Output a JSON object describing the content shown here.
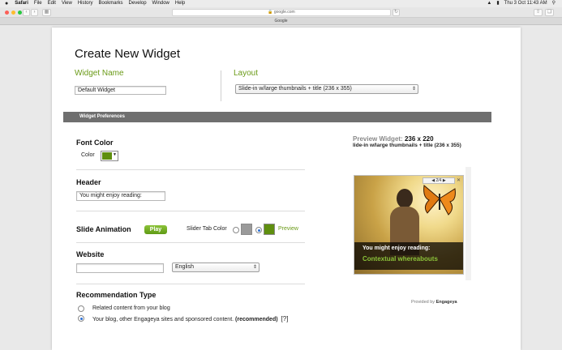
{
  "menubar": {
    "apple": "",
    "items": [
      "Safari",
      "File",
      "Edit",
      "View",
      "History",
      "Bookmarks",
      "Develop",
      "Window",
      "Help"
    ],
    "clock": "Thu 3 Oct  11:43 AM"
  },
  "browser": {
    "url": "google.com",
    "tab_title": "Google"
  },
  "form": {
    "title": "Create New Widget",
    "widget_name_label": "Widget Name",
    "widget_name_value": "Default Widget",
    "layout_label": "Layout",
    "layout_value": "Slide-in w/large thumbnails + title (236 x 355)",
    "prefs_bar": "Widget Preferences"
  },
  "font_color": {
    "heading": "Font Color",
    "color_label": "Color",
    "color": "#5f8f0f"
  },
  "header": {
    "heading": "Header",
    "value": "You might enjoy reading:"
  },
  "slide_animation": {
    "heading": "Slide Animation",
    "play_label": "Play",
    "tab_color_label": "Slider Tab Color",
    "preview_label": "Preview",
    "selected": "green"
  },
  "website": {
    "heading": "Website",
    "url_value": "",
    "language": "English"
  },
  "recommendation": {
    "heading": "Recommendation Type",
    "option1": "Related content from your blog",
    "option2_text": "Your blog, other Engageya sites and sponsored content.",
    "option2_bold": "(recommended)",
    "help": "[?]",
    "selected": 2
  },
  "preview": {
    "label": "Preview Widget:",
    "size": "236 x 220",
    "sub": "lide-in w/large thumbnails + title (236 x 355)",
    "pager": "2/4",
    "caption_head": "You might enjoy reading:",
    "caption_link": "Contextual whereabouts",
    "provided_text": "Provided by",
    "provided_brand": "Engageya"
  },
  "colors": {
    "accent_green": "#6a9a17",
    "bar_grey": "#6f6f6f"
  }
}
